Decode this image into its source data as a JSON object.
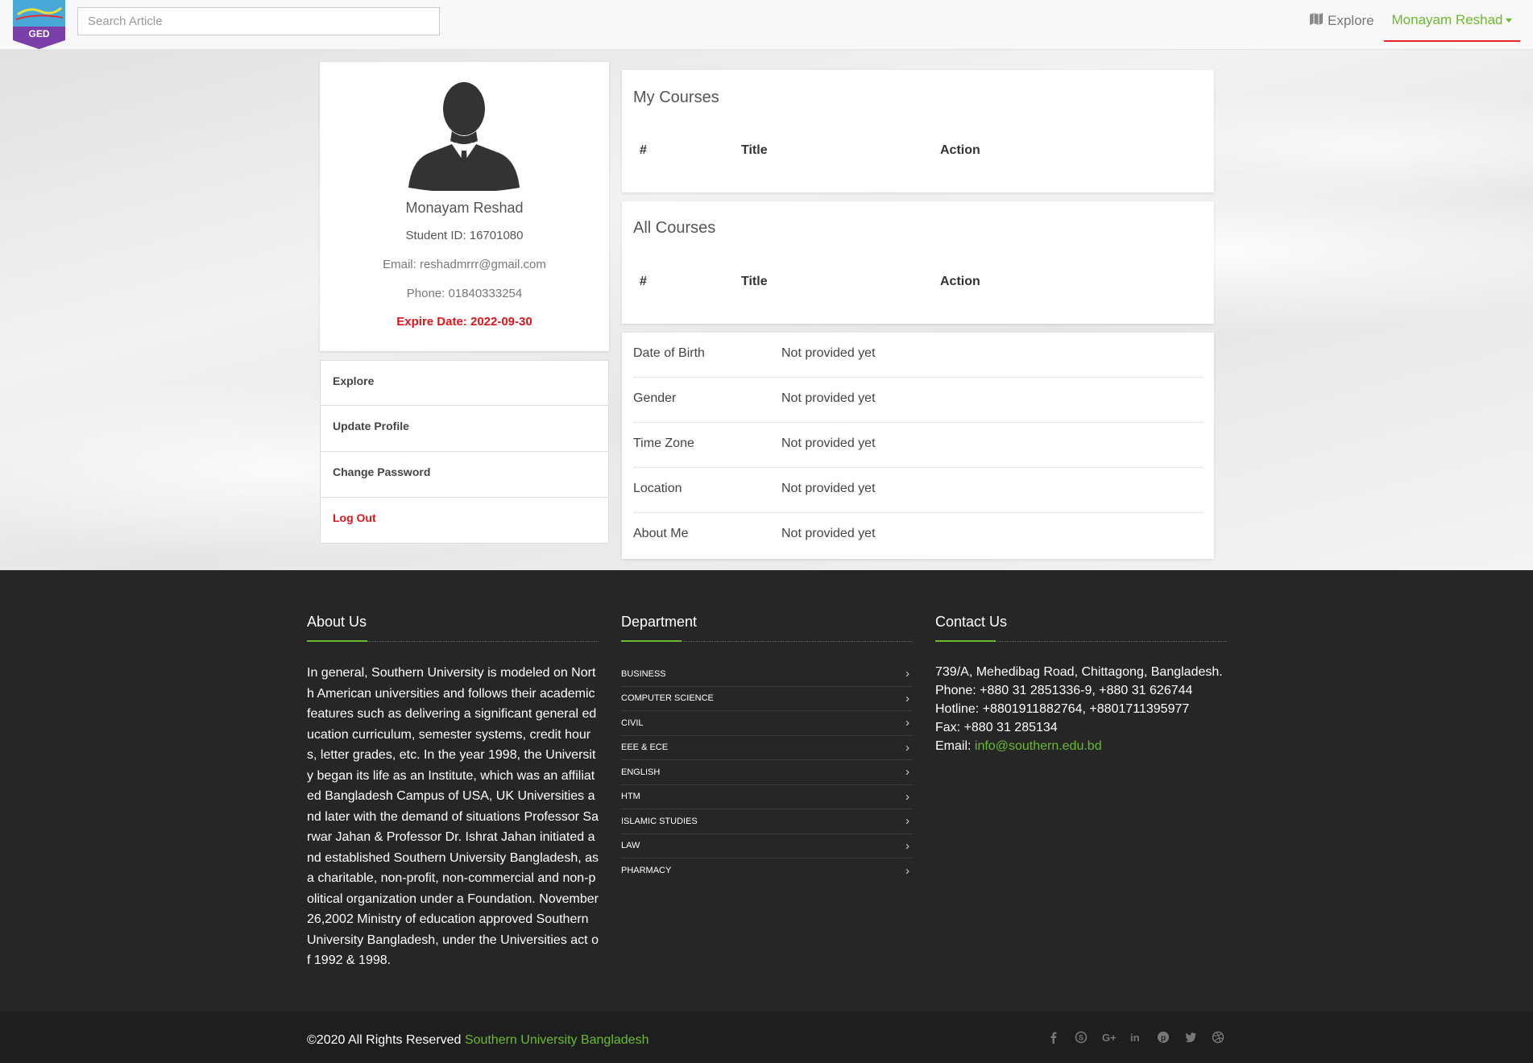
{
  "header": {
    "logo_text": "GED",
    "search_placeholder": "Search Article",
    "explore_label": "Explore",
    "user_name": "Monayam Reshad"
  },
  "profile": {
    "name": "Monayam Reshad",
    "student_id": "Student ID: 16701080",
    "email": "Email: reshadmrrr@gmail.com",
    "phone": "Phone: 01840333254",
    "expire": "Expire Date: 2022-09-30"
  },
  "side_menu": {
    "items": [
      "Explore",
      "Update Profile",
      "Change Password",
      "Log Out"
    ]
  },
  "my_courses": {
    "title": "My Courses",
    "columns": [
      "#",
      "Title",
      "Action"
    ]
  },
  "all_courses": {
    "title": "All Courses",
    "columns": [
      "#",
      "Title",
      "Action"
    ]
  },
  "info": {
    "rows": [
      {
        "label": "Date of Birth",
        "value": "Not provided yet"
      },
      {
        "label": "Gender",
        "value": "Not provided yet"
      },
      {
        "label": "Time Zone",
        "value": "Not provided yet"
      },
      {
        "label": "Location",
        "value": "Not provided yet"
      },
      {
        "label": "About Me",
        "value": "Not provided yet"
      }
    ]
  },
  "footer": {
    "about_title": "About Us",
    "about_text": "In general, Southern University is modeled on North American universities and follows their academic features such as delivering a significant general education curriculum, semester systems, credit hours, letter grades, etc. In the year 1998, the University began its life as an Institute, which was an affiliated Bangladesh Campus of USA, UK Universities and later with the demand of situations Professor Sarwar Jahan & Professor Dr. Ishrat Jahan initiated and established Southern University Bangladesh, as a charitable, non-profit, non-commercial and non-political organization under a Foundation. November 26,2002 Ministry of education approved Southern University Bangladesh, under the Universities act of 1992 & 1998.",
    "department_title": "Department",
    "departments": [
      "BUSINESS",
      "COMPUTER SCIENCE",
      "CIVIL",
      "EEE & ECE",
      "ENGLISH",
      "HTM",
      "ISLAMIC STUDIES",
      "LAW",
      "PHARMACY"
    ],
    "contact_title": "Contact Us",
    "contact_address": "739/A, Mehedibag Road, Chittagong, Bangladesh.",
    "contact_phone": "Phone: +880 31 2851336-9, +880 31 626744",
    "contact_hotline": "Hotline: +8801911882764, +8801711395977",
    "contact_fax": "Fax: +880 31 285134",
    "contact_email_label": "Email: ",
    "contact_email": "info@southern.edu.bd",
    "copyright": "©2020 All Rights Reserved ",
    "copyright_link": "Southern University Bangladesh",
    "social_icons": [
      "facebook-icon",
      "skype-icon",
      "google-plus-icon",
      "linkedin-icon",
      "pinterest-icon",
      "twitter-icon",
      "dribbble-icon"
    ]
  },
  "colors": {
    "accent_green": "#6abb2c",
    "danger_red": "#e0141a",
    "footer_bg": "#262626"
  }
}
